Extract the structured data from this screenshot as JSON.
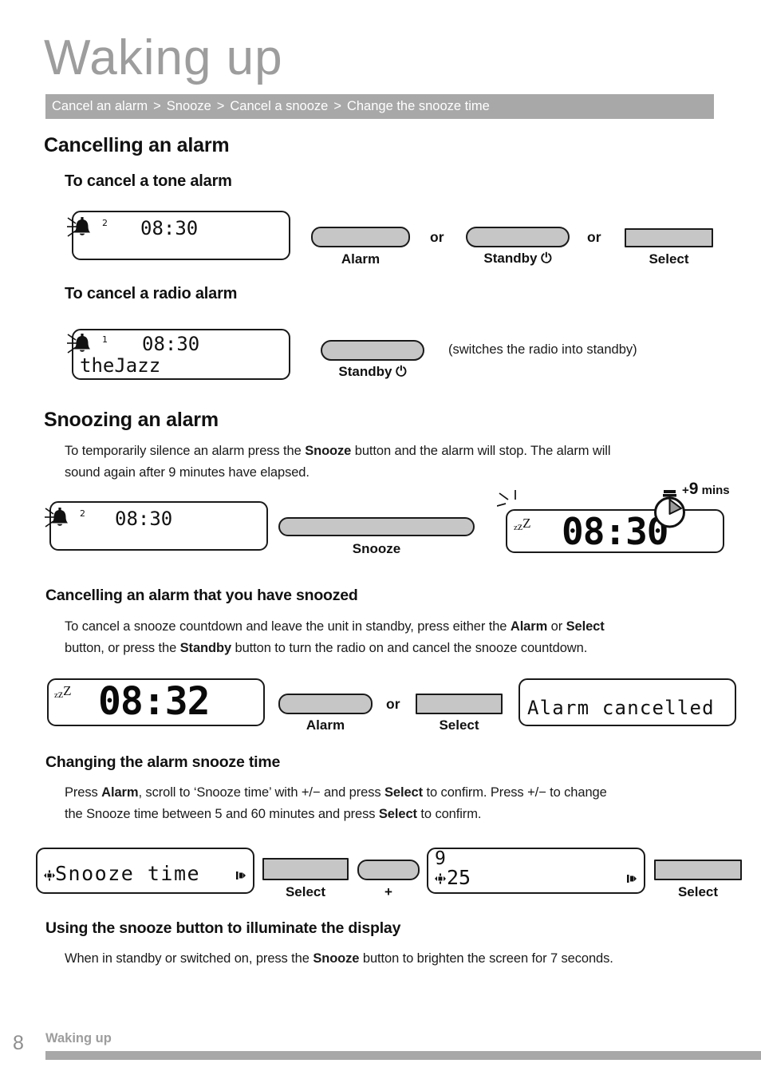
{
  "page": {
    "title": "Waking up",
    "footer_label": "Waking up",
    "page_number": "8",
    "colors": {
      "accent_gray": "#a8a8a8",
      "title_gray": "#9d9d9d",
      "button_fill": "#c6c6c6",
      "ink": "#1a1a1a"
    }
  },
  "breadcrumb": {
    "separator": ">",
    "items": [
      "Cancel an alarm",
      "Snooze",
      "Cancel a snooze",
      "Change the snooze time"
    ]
  },
  "sections": {
    "cancelling_alarm": {
      "heading": "Cancelling an alarm",
      "tone": {
        "heading": "To cancel a tone alarm",
        "display": {
          "alarm_number": "2",
          "time": "08:30",
          "indicator": "bell-ringing-icon"
        },
        "buttons": [
          {
            "label": "Alarm",
            "shape": "rounded"
          },
          {
            "label": "Standby ⏻",
            "shape": "pill"
          },
          {
            "label": "Select",
            "shape": "square"
          }
        ],
        "connector": "or"
      },
      "radio": {
        "heading": "To cancel a radio alarm",
        "display": {
          "alarm_number": "1",
          "time": "08:30",
          "station": "theJazz",
          "indicator": "bell-ringing-icon"
        },
        "button": {
          "label": "Standby ⏻",
          "shape": "pill"
        },
        "note": "(switches the radio into standby)"
      }
    },
    "snoozing_alarm": {
      "heading": "Snoozing an alarm",
      "body_line1_a": "To temporarily silence an alarm press the ",
      "body_bold1": "Snooze",
      "body_line1_b": " button and the alarm will stop. The alarm will",
      "body_line2": "sound again after 9 minutes have elapsed.",
      "display_before": {
        "alarm_number": "2",
        "time": "08:30",
        "indicator": "bell-ringing-icon"
      },
      "button": {
        "label": "Snooze",
        "shape": "pill"
      },
      "display_after": {
        "time": "08:30",
        "indicator": "snooze-zzz-icon"
      },
      "annotation": {
        "plus": "+",
        "value": "9",
        "unit": "mins",
        "icon": "timer-icon"
      }
    },
    "cancelling_snoozed": {
      "heading": "Cancelling an alarm that you have snoozed",
      "body_line1_a": "To cancel a snooze countdown and leave the unit in standby, press either the ",
      "body_bold1": "Alarm",
      "body_line1_mid": " or ",
      "body_bold2": "Select",
      "body_line2_a": "button, or press the ",
      "body_bold3": "Standby",
      "body_line2_b": " button to turn the radio on and cancel the snooze countdown.",
      "display_before": {
        "time": "08:32",
        "indicator": "snooze-zzz-icon"
      },
      "buttons": [
        {
          "label": "Alarm",
          "shape": "rounded"
        },
        {
          "label": "Select",
          "shape": "square"
        }
      ],
      "connector": "or",
      "display_after": {
        "message": "Alarm cancelled"
      }
    },
    "changing_snooze_time": {
      "heading": "Changing the alarm snooze time",
      "body_line1_a": "Press ",
      "body_bold1": "Alarm",
      "body_line1_b": ", scroll to ‘Snooze time’ with +/− and press ",
      "body_bold2": "Select",
      "body_line1_c": " to confirm. Press  +/−  to change",
      "body_line2_a": "the Snooze time between 5 and 60 minutes and press ",
      "body_bold3": "Select",
      "body_line2_b": " to confirm.",
      "display_menu": {
        "label": "Snooze time",
        "left_marker": "select-marker-icon",
        "right_marker": "scroll-marker-icon"
      },
      "buttons": [
        {
          "label": "Select",
          "shape": "square"
        },
        {
          "label": "+",
          "shape": "rounded"
        },
        {
          "label": "Select",
          "shape": "square"
        }
      ],
      "display_value": {
        "top_line": "9",
        "value": "25",
        "left_marker": "select-marker-icon",
        "right_marker": "scroll-marker-icon"
      }
    },
    "illuminate_display": {
      "heading": "Using the snooze button to illuminate the display",
      "body_line1_a": "When in standby or switched on, press the ",
      "body_bold1": "Snooze",
      "body_line1_b": " button to brighten the screen for 7 seconds."
    }
  }
}
